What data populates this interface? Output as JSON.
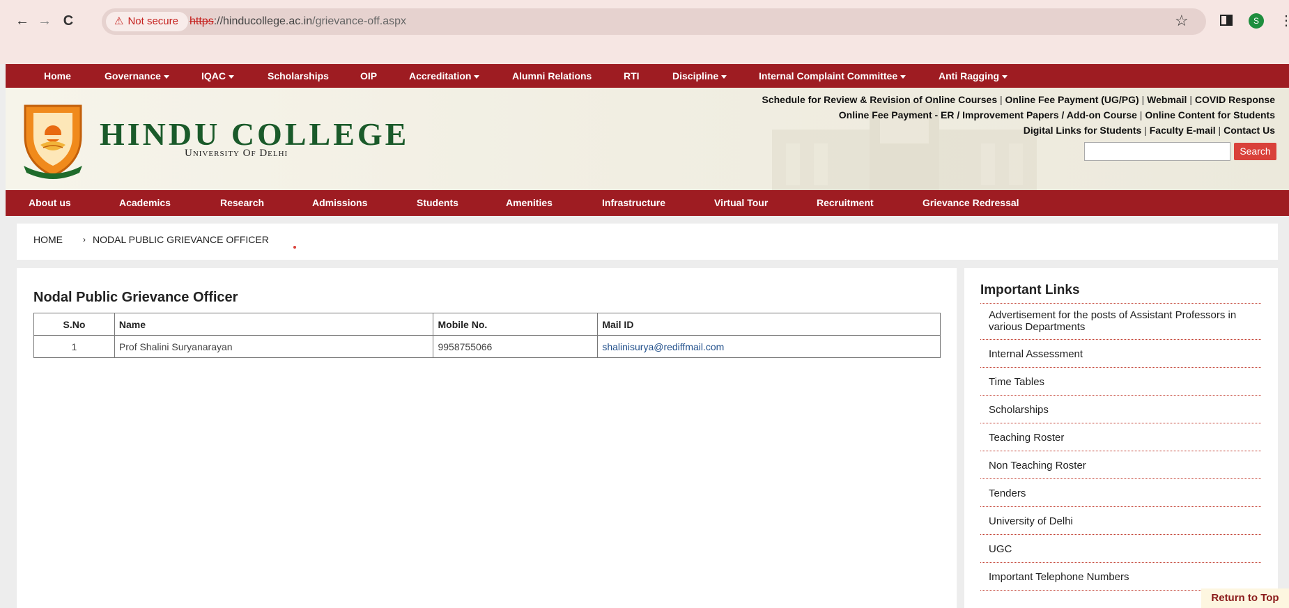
{
  "browser": {
    "back": "←",
    "forward": "→",
    "reload": "C",
    "security_text": "Not secure",
    "url_scheme": "https",
    "url_rest": "://hinducollege.ac.in",
    "url_path": "/grievance-off.aspx",
    "profile_initial": "S"
  },
  "top_nav": [
    {
      "label": "Home",
      "dropdown": false
    },
    {
      "label": "Governance",
      "dropdown": true
    },
    {
      "label": "IQAC",
      "dropdown": true
    },
    {
      "label": "Scholarships",
      "dropdown": false
    },
    {
      "label": "OIP",
      "dropdown": false
    },
    {
      "label": "Accreditation",
      "dropdown": true
    },
    {
      "label": "Alumni Relations",
      "dropdown": false
    },
    {
      "label": "RTI",
      "dropdown": false
    },
    {
      "label": "Discipline",
      "dropdown": true
    },
    {
      "label": "Internal Complaint Committee",
      "dropdown": true
    },
    {
      "label": "Anti Ragging",
      "dropdown": true
    }
  ],
  "header": {
    "college_name": "HINDU COLLEGE",
    "university": "University Of Delhi",
    "quick_links": [
      [
        "Schedule for Review & Revision of Online Courses",
        "Online Fee Payment (UG/PG)",
        "Webmail",
        "COVID Response"
      ],
      [
        "Online Fee Payment - ER / Improvement Papers / Add-on Course",
        "Online Content for Students"
      ],
      [
        "Digital Links for Students",
        "Faculty E-mail",
        "Contact Us"
      ]
    ],
    "search_button": "Search",
    "search_value": ""
  },
  "main_nav": [
    "About us",
    "Academics",
    "Research",
    "Admissions",
    "Students",
    "Amenities",
    "Infrastructure",
    "Virtual Tour",
    "Recruitment",
    "Grievance Redressal"
  ],
  "breadcrumb": {
    "home": "HOME",
    "separator": "›",
    "current": "NODAL PUBLIC GRIEVANCE OFFICER"
  },
  "content": {
    "title": "Nodal Public Grievance Officer",
    "columns": [
      "S.No",
      "Name",
      "Mobile No.",
      "Mail ID"
    ],
    "rows": [
      {
        "sno": "1",
        "name": "Prof Shalini Suryanarayan",
        "mobile": "9958755066",
        "mail": "shalinisurya@rediffmail.com"
      }
    ]
  },
  "sidebar": {
    "title": "Important Links",
    "links": [
      "Advertisement for the posts of Assistant Professors in various Departments",
      "Internal Assessment",
      "Time Tables",
      "Scholarships",
      "Teaching Roster",
      "Non Teaching Roster",
      "Tenders",
      "University of Delhi",
      "UGC",
      "Important Telephone Numbers"
    ]
  },
  "return_to_top": "Return to Top",
  "colors": {
    "brand_red": "#9e1c22",
    "college_green": "#1a5a2a",
    "search_red": "#d9413a"
  }
}
